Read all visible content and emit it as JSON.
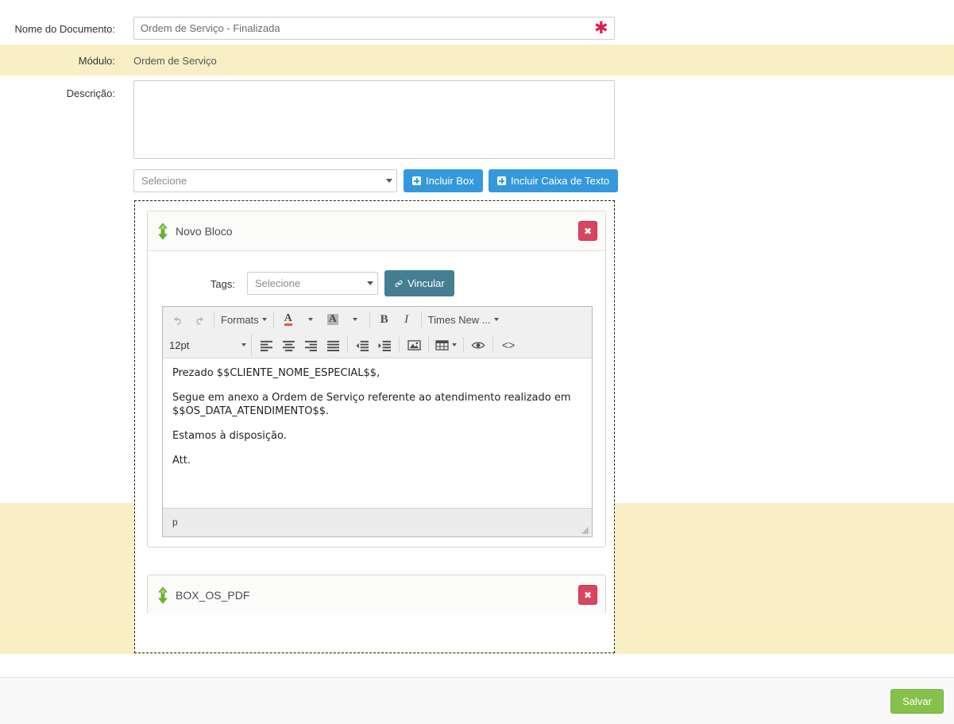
{
  "form": {
    "doc_name_label": "Nome do Documento:",
    "doc_name_value": "Ordem de Serviço - Finalizada",
    "required_marker": "✱",
    "modulo_label": "Módulo:",
    "modulo_value": "Ordem de Serviço",
    "descricao_label": "Descrição:",
    "descricao_value": ""
  },
  "add_bar": {
    "select_value": "Selecione",
    "incluir_box_label": "Incluir Box",
    "incluir_caixa_texto_label": "Incluir Caixa de Texto"
  },
  "blocks": [
    {
      "title": "Novo Bloco",
      "delete_label": "✖",
      "tags_label": "Tags:",
      "tags_select_value": "Selecione",
      "vincular_label": "Vincular",
      "vincular_icon": "link-icon",
      "editor": {
        "undo_icon": "undo-icon",
        "redo_icon": "redo-icon",
        "formats_label": "Formats",
        "text_color_label": "A",
        "bg_color_label": "A",
        "bold_label": "B",
        "italic_label": "I",
        "font_family_label": "Times New ...",
        "font_size_label": "12pt",
        "align_left_icon": "align-left-icon",
        "align_center_icon": "align-center-icon",
        "align_right_icon": "align-right-icon",
        "align_justify_icon": "align-justify-icon",
        "outdent_icon": "outdent-icon",
        "indent_icon": "indent-icon",
        "image_icon": "image-icon",
        "table_icon": "table-icon",
        "preview_icon": "eye-icon",
        "source_code_label": "<>",
        "paragraphs": [
          "Prezado $$CLIENTE_NOME_ESPECIAL$$,",
          "Segue em anexo a Ordem de Serviço referente ao atendimento realizado em $$OS_DATA_ATENDIMENTO$$.",
          "Estamos à disposição.",
          "Att."
        ],
        "status_path": "p"
      }
    },
    {
      "title": "BOX_OS_PDF",
      "delete_label": "✖"
    }
  ],
  "footer": {
    "save_label": "Salvar"
  },
  "colors": {
    "highlight_band": "#f8f0c4",
    "primary_blue": "#3498dd",
    "vincular_teal": "#457d91",
    "danger_red": "#d9455f",
    "save_green": "#84c24a",
    "required_red": "#d9214f"
  }
}
